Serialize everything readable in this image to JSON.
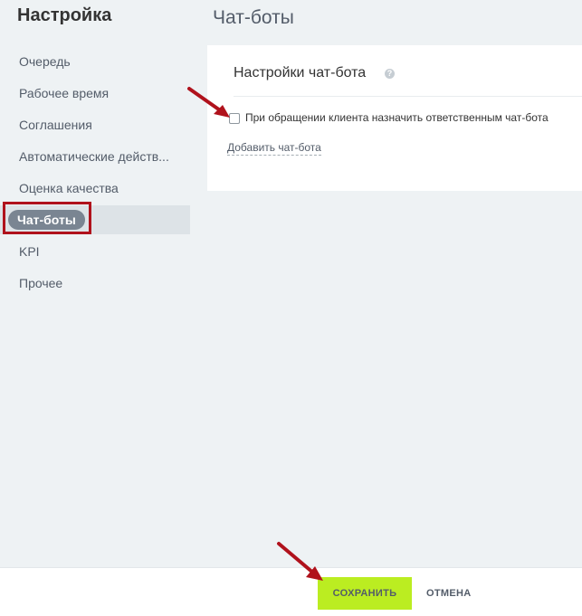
{
  "sidebar": {
    "title": "Настройка",
    "items": [
      {
        "label": "Очередь"
      },
      {
        "label": "Рабочее время"
      },
      {
        "label": "Соглашения"
      },
      {
        "label": "Автоматические действ..."
      },
      {
        "label": "Оценка качества"
      },
      {
        "label": "Чат-боты",
        "active": true
      },
      {
        "label": "KPI"
      },
      {
        "label": "Прочее"
      }
    ]
  },
  "main": {
    "title": "Чат-боты",
    "card": {
      "header": "Настройки чат-бота",
      "help_icon": "?",
      "checkbox_label": "При обращении клиента назначить ответственным чат-бота",
      "checkbox_checked": false,
      "add_link": "Добавить чат-бота"
    }
  },
  "footer": {
    "save_label": "СОХРАНИТЬ",
    "cancel_label": "ОТМЕНА"
  },
  "colors": {
    "accent_save": "#bbed21",
    "annotation_red": "#b0121c",
    "active_pill": "#7a8592"
  }
}
